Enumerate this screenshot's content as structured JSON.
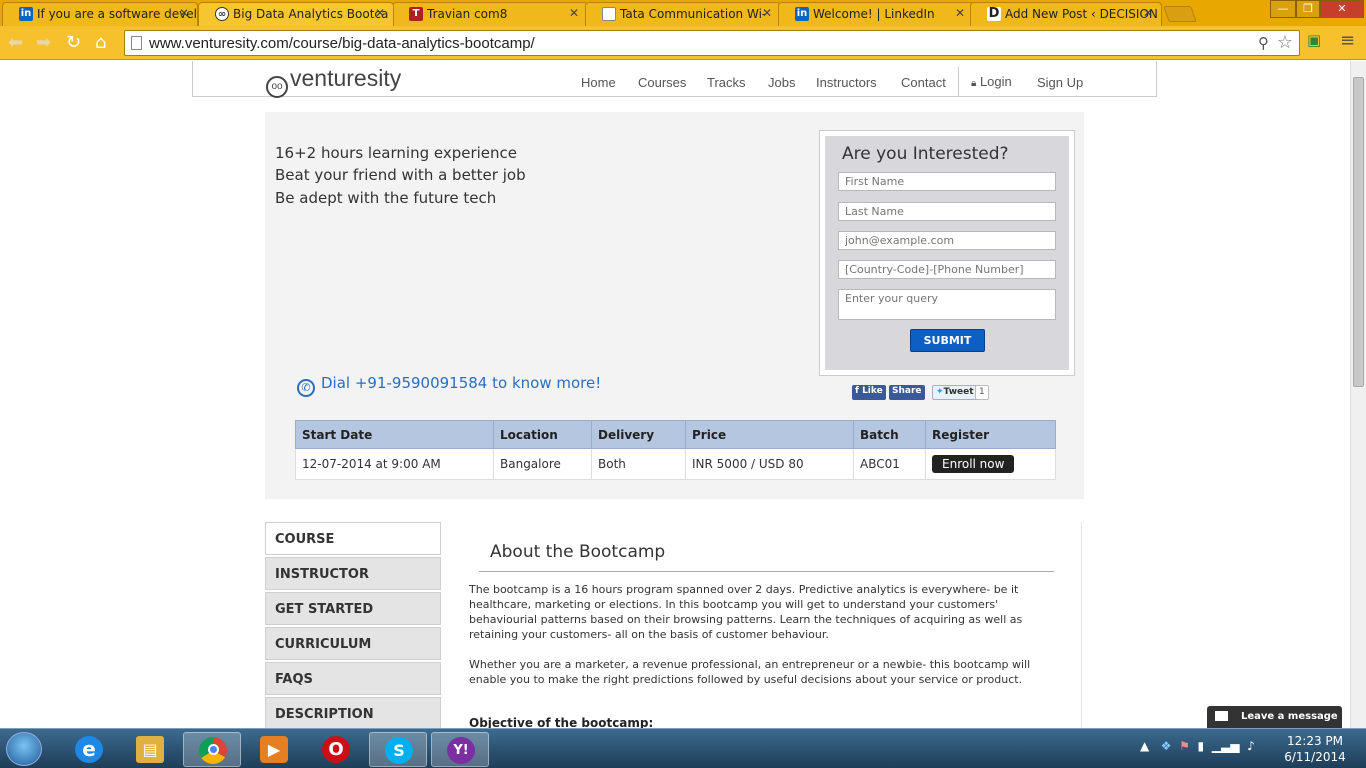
{
  "browser": {
    "tabs": [
      {
        "title": "If you are a software devel",
        "favicon": "in",
        "color": "#0a66c2"
      },
      {
        "title": "Big Data Analytics Bootca",
        "favicon": "owl",
        "color": "#333333"
      },
      {
        "title": "Travian com8",
        "favicon": "T",
        "color": "#b02020"
      },
      {
        "title": "Tata Communication Wi-",
        "favicon": "doc",
        "color": "#ffffff"
      },
      {
        "title": "Welcome! | LinkedIn",
        "favicon": "in",
        "color": "#0a66c2"
      },
      {
        "title": "Add New Post ‹ DECISION",
        "favicon": "D",
        "color": "#222222"
      }
    ],
    "url": "www.venturesity.com/course/big-data-analytics-bootcamp/"
  },
  "site": {
    "logo": "venturesity",
    "nav": [
      "Home",
      "Courses",
      "Tracks",
      "Jobs",
      "Instructors",
      "Contact"
    ],
    "login": "Login",
    "signup": "Sign Up"
  },
  "hero": {
    "lines": [
      "16+2 hours learning experience",
      "Beat your friend with a better job",
      "Be adept with the future tech"
    ],
    "dial": "Dial +91-9590091584 to know more!"
  },
  "form": {
    "title": "Are you Interested?",
    "first_name": "First Name",
    "last_name": "Last Name",
    "email": "john@example.com",
    "phone": "[Country-Code]-[Phone Number]",
    "query": "Enter your query",
    "submit": "SUBMIT"
  },
  "social": {
    "like": "Like",
    "share": "Share",
    "tweet": "Tweet",
    "tweet_count": "1"
  },
  "schedule": {
    "headers": [
      "Start Date",
      "Location",
      "Delivery",
      "Price",
      "Batch",
      "Register"
    ],
    "row": {
      "start_date": "12-07-2014 at 9:00 AM",
      "location": "Bangalore",
      "delivery": "Both",
      "price": "INR 5000 / USD 80",
      "batch": "ABC01",
      "register": "Enroll now"
    }
  },
  "sidebar": [
    "COURSE",
    "INSTRUCTOR",
    "GET STARTED",
    "CURRICULUM",
    "FAQS",
    "DESCRIPTION"
  ],
  "content": {
    "heading": "About the Bootcamp",
    "para1": "The bootcamp is a 16 hours program spanned over 2 days. Predictive analytics is everywhere- be it healthcare, marketing or elections. In this bootcamp you will get to understand your customers' behaviourial patterns based on their browsing patterns. Learn the techniques of acquiring as well as retaining your customers- all on the basis of customer behaviour.",
    "para2": "Whether you are a marketer, a revenue professional, an entrepreneur or a newbie- this bootcamp will enable you to make the right predictions followed by useful decisions about your service or product.",
    "objective": "Objective of the bootcamp:"
  },
  "chat": {
    "label": "Leave a message"
  },
  "taskbar": {
    "time": "12:23 PM",
    "date": "6/11/2014",
    "apps": [
      {
        "name": "ie-icon",
        "glyph": "e",
        "color": "#1e88e5"
      },
      {
        "name": "explorer-icon",
        "glyph": "▤",
        "color": "#e0b040"
      },
      {
        "name": "chrome-icon",
        "glyph": "◉",
        "color": "#d44"
      },
      {
        "name": "media-player-icon",
        "glyph": "▶",
        "color": "#e67e22"
      },
      {
        "name": "opera-icon",
        "glyph": "O",
        "color": "#cc0f16"
      },
      {
        "name": "skype-icon",
        "glyph": "S",
        "color": "#00aff0"
      },
      {
        "name": "yahoo-messenger-icon",
        "glyph": "Y!",
        "color": "#7b2fa0"
      }
    ]
  }
}
